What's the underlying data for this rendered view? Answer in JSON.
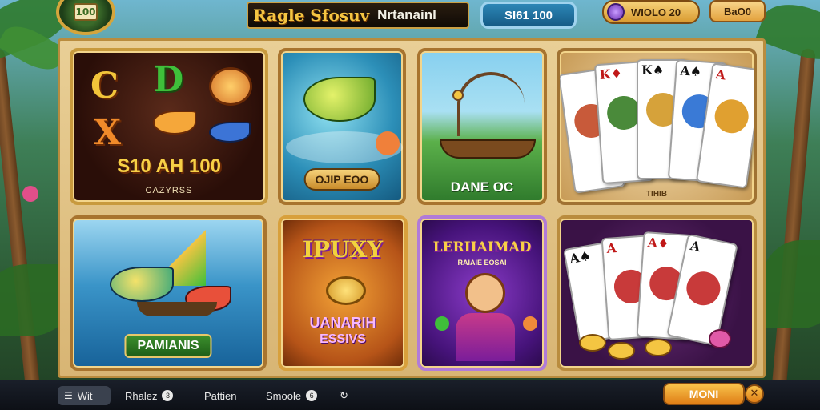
{
  "header": {
    "logo_text": "100",
    "title_part1": "Ragle Sfosuv",
    "title_part2": "Nrtanainl",
    "balance": "SI61 100",
    "coins": "WIOLO 20",
    "top_button": "BaO0"
  },
  "tiles": [
    {
      "id": "slots",
      "label": "S10 AH 100",
      "sublabel": "CAZYRSS"
    },
    {
      "id": "fish",
      "label": "OJIP EOO"
    },
    {
      "id": "boat",
      "label": "DANE OC"
    },
    {
      "id": "cards",
      "label": "TIHIB"
    },
    {
      "id": "fishing",
      "label": "PAMIANIS"
    },
    {
      "id": "lucky",
      "label": "IPUXY",
      "sub1": "UANARIH",
      "sub2": "ESSIVS"
    },
    {
      "id": "character",
      "label": "LERIIAIMAD",
      "sublabel": "RAIAIE EOSAI"
    },
    {
      "id": "cards2",
      "label": ""
    }
  ],
  "bottom_bar": {
    "item1": "Wit",
    "item2": "Rhalez",
    "item2_badge": "3",
    "item3": "Pattien",
    "item4": "Smoole",
    "item4_badge": "6",
    "item5_icon": "refresh-icon",
    "button": "MONI",
    "circle_icon": "close-icon",
    "circle_glyph": "✕"
  },
  "colors": {
    "gold": "#f4c542",
    "board": "#e9cf96",
    "accent_blue": "#2c86b6"
  }
}
